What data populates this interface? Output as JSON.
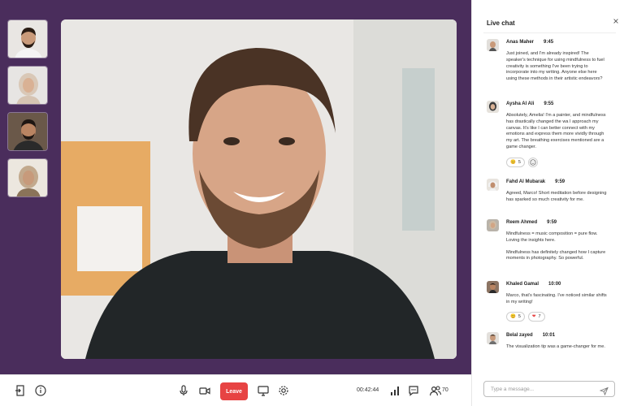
{
  "participants": [
    {
      "name": "participant-1",
      "skin": "#c99a7a",
      "hair": "#2a1c14",
      "bg": "#e9e6e3",
      "shirt": "#f4f4f4"
    },
    {
      "name": "participant-2",
      "skin": "#d9b194",
      "hair": "#d9c8b7",
      "bg": "#e7e5e3",
      "shirt": "#d6c4b3"
    },
    {
      "name": "participant-3",
      "skin": "#b98462",
      "hair": "#1e1612",
      "bg": "#6a5849",
      "shirt": "#2a2a2a"
    },
    {
      "name": "participant-4",
      "skin": "#c79a7b",
      "hair": "#c2a98d",
      "bg": "#ece7df",
      "shirt": "#8a7359"
    }
  ],
  "toolbar": {
    "leave_label": "Leave",
    "timer": "00:42:44",
    "participant_count": "70"
  },
  "chat": {
    "title": "Live chat",
    "input_placeholder": "Type a message...",
    "messages": [
      {
        "name": "Anas Maher",
        "time": "9:45",
        "paragraphs": [
          "Just joined, and I'm already inspired! The speaker's technique for using mindfulness to fuel creativity is something I've been trying to incorporate into my writing. Anyone else here using these methods in their artistic endeavors?"
        ]
      },
      {
        "name": "Aysha Al Ali",
        "time": "9:55",
        "paragraphs": [
          "Absolutely, Amelia! I'm a painter, and mindfulness has drastically changed the wa I approach my canvas. It's like I can better connect with my emotions and express them more vividly through my art. The breathing exercises mentioned are a game changer."
        ],
        "reactions": [
          {
            "emoji": "😊",
            "count": "5"
          }
        ]
      },
      {
        "name": "Fahd Al Mubarak",
        "time": "9:59",
        "paragraphs": [
          "Agreed, Marco! Short meditation before designing has sparked so much creativity for me."
        ]
      },
      {
        "name": "Reem Ahmed",
        "time": "9:59",
        "paragraphs": [
          "Mindfulness = music composition = pure flow. Loving the insights here.",
          "Mindfulness has definitely changed how I capture moments in photography. So powerful."
        ]
      },
      {
        "name": "Khaled Gamal",
        "time": "10:00",
        "paragraphs": [
          "Marco, that's fascinating. I've noticed similar shifts in my writing!"
        ],
        "reactions": [
          {
            "emoji": "😊",
            "count": "5"
          },
          {
            "emoji": "❤",
            "count": "7"
          }
        ]
      },
      {
        "name": "Belal zayed",
        "time": "10:01",
        "paragraphs": [
          "The visualization tip was a game-changer for me."
        ]
      }
    ]
  },
  "colors": {
    "stage": "#4a2d5c",
    "leave": "#e74343"
  }
}
